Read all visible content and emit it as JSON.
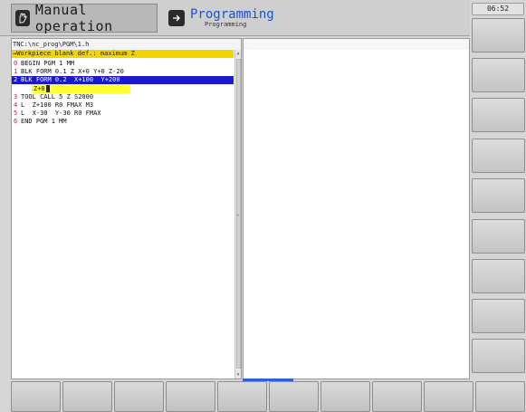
{
  "header": {
    "mode_manual": "Manual operation",
    "mode_programming": "Programming",
    "mode_programming_sub": "Programming",
    "clock": "06:52"
  },
  "program": {
    "path": "TNC:\\nc_prog\\PGM\\1.h",
    "blank_bar": "→Workpiece blank def.: maximum Z",
    "lines": [
      {
        "num": "0",
        "text": "BEGIN PGM 1 MM"
      },
      {
        "num": "1",
        "text": "BLK FORM 0.1 Z X+0 Y+0 Z-20"
      },
      {
        "num": "2",
        "text": "BLK FORM 0.2  X+100  Y+200"
      },
      {
        "num": "3",
        "text": "TOOL CALL 5 Z S2000"
      },
      {
        "num": "4",
        "text": "L  Z+100 R0 FMAX M3"
      },
      {
        "num": "5",
        "text": "L  X-30  Y-30 R0 FMAX"
      },
      {
        "num": "6",
        "text": "END PGM 1 MM"
      }
    ],
    "edit_field": "Z+0"
  },
  "colors": {
    "accent": "#1a4fd8",
    "selection": "#1a1acc",
    "highlight_yellow": "#ffff33",
    "blank_bar": "#f2d500",
    "line_number": "#c2185b"
  },
  "icons": {
    "manual": "hand-icon",
    "programming": "program-icon"
  }
}
